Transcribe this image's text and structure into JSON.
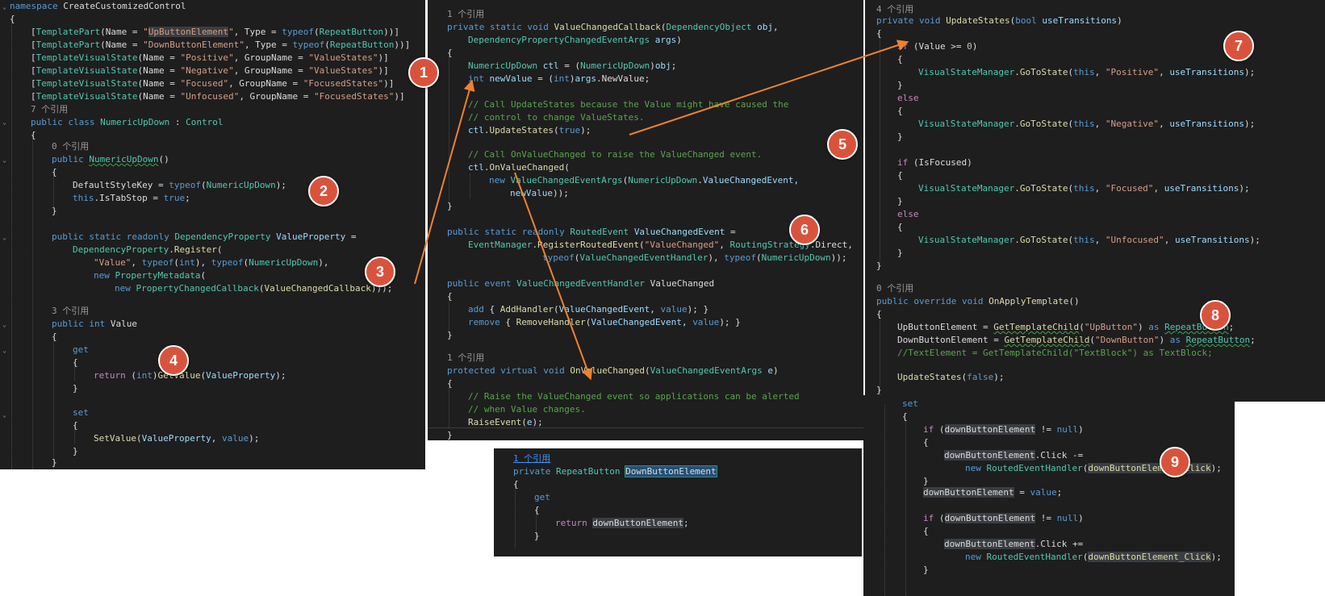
{
  "badges": [
    "1",
    "2",
    "3",
    "4",
    "5",
    "6",
    "7",
    "8",
    "9"
  ],
  "ref_labels": {
    "seven": "7 个引用",
    "zero": "0 个引用",
    "three": "3 个引用",
    "one": "1 个引用",
    "four": "4 个引用"
  },
  "panel1": {
    "namespace": "CreateCustomizedControl",
    "up_button_element": "UpButtonElement",
    "down_button_element": "DownButtonElement",
    "repeat_button_type": "RepeatButton",
    "visual_states": [
      {
        "name": "Positive",
        "group": "ValueStates"
      },
      {
        "name": "Negative",
        "group": "ValueStates"
      },
      {
        "name": "Focused",
        "group": "FocusedStates"
      },
      {
        "name": "Unfocused",
        "group": "FocusedStates"
      }
    ],
    "class_name": "NumericUpDown",
    "base_class": "Control",
    "value_property_name": "\"Value\""
  },
  "panel2": {
    "comment_update_1": "// Call UpdateStates because the Value might have caused the",
    "comment_update_2": "// control to change ValueStates.",
    "comment_onchanged": "// Call OnValueChanged to raise the ValueChanged event.",
    "event_name_string": "\"ValueChanged\"",
    "comment_raise_1": "// Raise the ValueChanged event so applications can be alerted",
    "comment_raise_2": "// when Value changes."
  },
  "panel3": {
    "state_positive": "\"Positive\"",
    "state_negative": "\"Negative\"",
    "state_focused": "\"Focused\"",
    "state_unfocused": "\"Unfocused\"",
    "up_button_string": "\"UpButton\"",
    "down_button_string": "\"DownButton\"",
    "text_element_comment": "//TextElement = GetTemplateChild(\"TextBlock\") as TextBlock;"
  }
}
